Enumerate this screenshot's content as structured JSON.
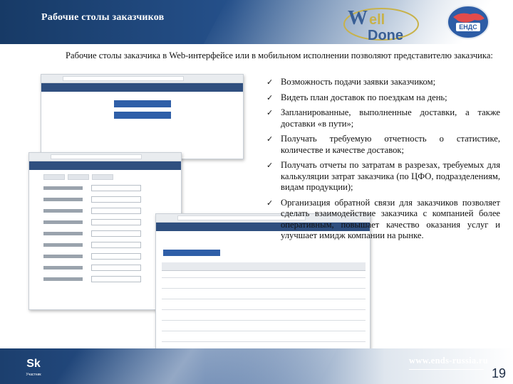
{
  "header": {
    "title": "Рабочие столы заказчиков"
  },
  "logos": {
    "welldone": "WellDone",
    "ends_badge": "ЕНДС",
    "skolkovo_mark": "Sk",
    "skolkovo_sub": "Участник"
  },
  "intro": {
    "text": "Рабочие столы заказчика в Web-интерфейсе или в мобильном исполнении позволяют представителю заказчика:"
  },
  "checklist": [
    {
      "text": "Возможность подачи заявки заказчиком;"
    },
    {
      "text": "Видеть план доставок по поездкам на день;"
    },
    {
      "text": "Запланированные, выполненные доставки, а также доставки «в пути»;"
    },
    {
      "text": "Получать требуемую отчетность о статистике, количестве и качестве доставок;"
    },
    {
      "text": "Получать отчеты по затратам в разрезах, требуемых для калькуляции затрат заказчика (по ЦФО, подразделениям, видам продукции);"
    },
    {
      "text": "Организация обратной связи для заказчиков позволяет сделать взаимодействие заказчика с компанией более оперативным, повышает качество оказания услуг и улучшает имидж компании на рынке."
    }
  ],
  "check_glyph": "✓",
  "footer": {
    "url": "www.ends-russia.ru",
    "page_number": "19"
  },
  "colors": {
    "header_dark": "#173a66",
    "header_mid": "#25508a",
    "app_blue": "#2f5fa8"
  }
}
